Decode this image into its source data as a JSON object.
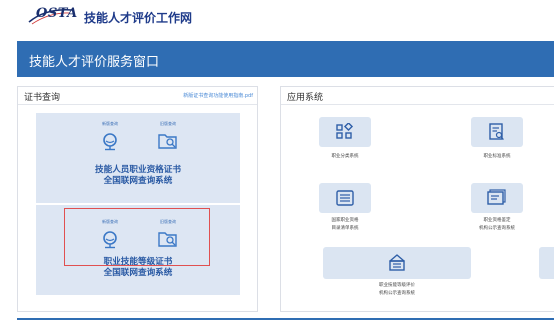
{
  "header": {
    "logo_text": "OSTA",
    "site_title": "技能人才评价工作网"
  },
  "banner": {
    "title": "技能人才评价服务窗口"
  },
  "cert_panel": {
    "title": "证书查询",
    "guide_link": "新版证书查询功能使用指南.pdf",
    "blocks": [
      {
        "icons": [
          {
            "label": "新版查询",
            "icon": "search-icon"
          },
          {
            "label": "旧版查询",
            "icon": "folder-search-icon"
          }
        ],
        "title_line1": "技能人员职业资格证书",
        "title_line2": "全国联网查询系统"
      },
      {
        "icons": [
          {
            "label": "新版查询",
            "icon": "search-icon"
          },
          {
            "label": "旧版查询",
            "icon": "folder-search-icon"
          }
        ],
        "title_line1": "职业技能等级证书",
        "title_line2": "全国联网查询系统"
      }
    ]
  },
  "app_panel": {
    "title": "应用系统",
    "apps": [
      {
        "label_line1": "职业分类系统",
        "label_line2": "",
        "icon": "grid-icon"
      },
      {
        "label_line1": "职业标准系统",
        "label_line2": "",
        "icon": "document-search-icon"
      },
      {
        "label_line1": "国家职业资格",
        "label_line2": "目录清单系统",
        "icon": "list-icon"
      },
      {
        "label_line1": "职业资格鉴定",
        "label_line2": "机构公示查询系统",
        "icon": "monitor-icon"
      },
      {
        "label_line1": "职业技能等级评价",
        "label_line2": "机构公示查询系统",
        "icon": "institution-icon"
      }
    ]
  },
  "colors": {
    "banner": "#2f6db3",
    "tile_bg": "#dde6f3",
    "highlight": "#e05050"
  }
}
